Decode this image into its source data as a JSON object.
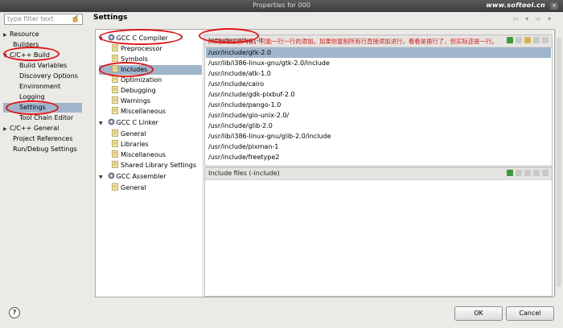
{
  "window": {
    "title": "Properties for 000",
    "brand": "www.softool.cn",
    "close": "×"
  },
  "filter": {
    "placeholder": "type filter text"
  },
  "left_tree": [
    {
      "label": "Resource",
      "arrow": "▶"
    },
    {
      "label": "Builders",
      "arrow": ""
    },
    {
      "label": "C/C++ Build",
      "arrow": "▼"
    },
    {
      "label": "Build Variables",
      "arrow": ""
    },
    {
      "label": "Discovery Options",
      "arrow": ""
    },
    {
      "label": "Environment",
      "arrow": ""
    },
    {
      "label": "Logging",
      "arrow": ""
    },
    {
      "label": "Settings",
      "arrow": "",
      "selected": true
    },
    {
      "label": "Tool Chain Editor",
      "arrow": ""
    },
    {
      "label": "C/C++ General",
      "arrow": "▶"
    },
    {
      "label": "Project References",
      "arrow": ""
    },
    {
      "label": "Run/Debug Settings",
      "arrow": ""
    }
  ],
  "settings": {
    "title": "Settings",
    "history_nav": "⇦ ▾ ⇨ ▾"
  },
  "tool_tree": [
    {
      "label": "GCC C Compiler",
      "kind": "gear",
      "arrow": "▼"
    },
    {
      "label": "Preprocessor",
      "kind": "page"
    },
    {
      "label": "Symbols",
      "kind": "page"
    },
    {
      "label": "Includes",
      "kind": "page",
      "selected": true
    },
    {
      "label": "Optimization",
      "kind": "page"
    },
    {
      "label": "Debugging",
      "kind": "page"
    },
    {
      "label": "Warnings",
      "kind": "page"
    },
    {
      "label": "Miscellaneous",
      "kind": "page"
    },
    {
      "label": "GCC C Linker",
      "kind": "gear",
      "arrow": "▼"
    },
    {
      "label": "General",
      "kind": "page"
    },
    {
      "label": "Libraries",
      "kind": "page"
    },
    {
      "label": "Miscellaneous",
      "kind": "page"
    },
    {
      "label": "Shared Library Settings",
      "kind": "page"
    },
    {
      "label": "GCC Assembler",
      "kind": "gear",
      "arrow": "▼"
    },
    {
      "label": "General",
      "kind": "page"
    }
  ],
  "include_paths": {
    "header": "Include paths (-I)",
    "annotation": "//添加的路径内容。只能一行一行的添加。如果你复制所有行直接添加进行，看看是换行了，但实际还是一行。",
    "items": [
      "/usr/include/gtk-2.0",
      "/usr/lib/i386-linux-gnu/gtk-2.0/include",
      "/usr/include/atk-1.0",
      "/usr/include/cairo",
      "/usr/include/gdk-pixbuf-2.0",
      "/usr/include/pango-1.0",
      "/usr/include/gio-unix-2.0/",
      "/usr/include/glib-2.0",
      "/usr/lib/i386-linux-gnu/glib-2.0/include",
      "/usr/include/pixman-1",
      "/usr/include/freetype2"
    ],
    "selected_index": 0
  },
  "include_files": {
    "header": "Include files (-include)"
  },
  "buttons": {
    "help": "?",
    "ok": "OK",
    "cancel": "Cancel"
  },
  "colors": {
    "selection": "#9fb5cc",
    "annotation_red": "#e01515",
    "add_icon": "#3a9a3a"
  }
}
